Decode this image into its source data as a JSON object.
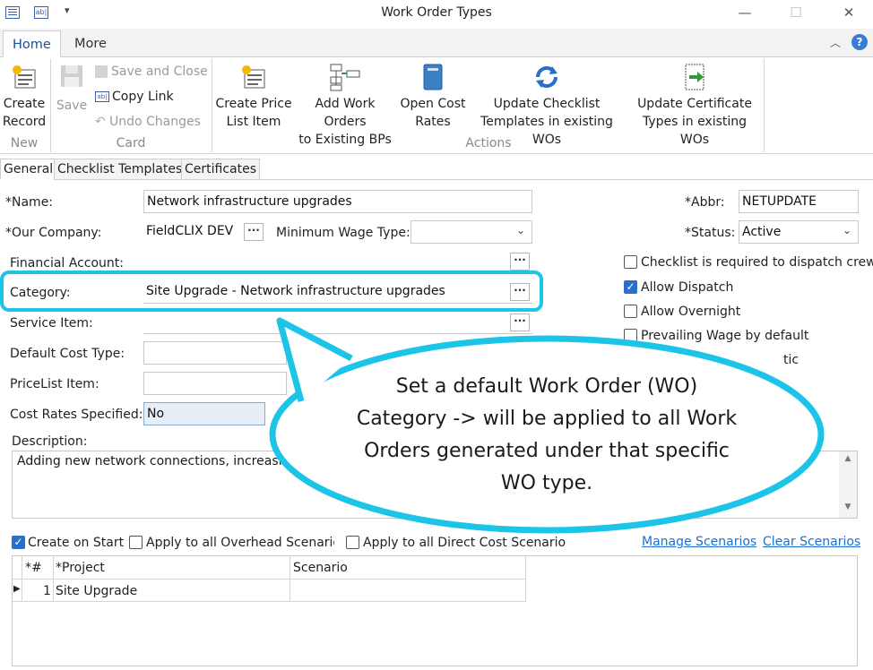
{
  "window": {
    "title": "Work Order Types",
    "minimize": "—",
    "maximize": "☐",
    "close": "✕"
  },
  "ribbon_tabs": [
    {
      "label": "Home"
    },
    {
      "label": "More"
    }
  ],
  "ribbon": {
    "new": {
      "create_record": [
        "Create",
        "Record"
      ],
      "group": "New"
    },
    "card": {
      "save": "Save",
      "save_close": "Save and Close",
      "copy_link": "Copy Link",
      "undo": "Undo Changes",
      "group": "Card"
    },
    "actions": {
      "create_price": [
        "Create Price",
        "List Item"
      ],
      "add_work_orders": [
        "Add Work Orders",
        "to Existing BPs"
      ],
      "open_cost": [
        "Open Cost",
        "Rates"
      ],
      "update_checklist": [
        "Update Checklist",
        "Templates in existing WOs"
      ],
      "update_cert": [
        "Update Certificate",
        "Types in existing WOs"
      ],
      "group": "Actions"
    }
  },
  "form_tabs": [
    {
      "label": "General"
    },
    {
      "label": "Checklist Templates"
    },
    {
      "label": "Certificates"
    }
  ],
  "form": {
    "name_label": "*Name:",
    "name_value": "Network infrastructure upgrades",
    "company_label": "*Our Company:",
    "company_value": "FieldCLIX DEV",
    "min_wage_label": "Minimum Wage Type:",
    "min_wage_value": "",
    "financial_label": "Financial Account:",
    "financial_value": "",
    "category_label": "Category:",
    "category_value": "Site Upgrade - Network infrastructure upgrades",
    "service_label": "Service Item:",
    "service_value": "",
    "cost_type_label": "Default Cost Type:",
    "cost_type_value": "",
    "pricelist_label": "PriceList Item:",
    "pricelist_value": "",
    "cost_rates_label": "Cost Rates Specified:",
    "cost_rates_value": "No",
    "description_label": "Description:",
    "description_value": "Adding new network connections, increasing",
    "abbr_label": "*Abbr:",
    "abbr_value": "NETUPDATE",
    "status_label": "*Status:",
    "status_value": "Active",
    "checklist_required": "Checklist is required to dispatch crew",
    "allow_dispatch": "Allow Dispatch",
    "allow_overnight": "Allow Overnight",
    "prevailing_wage": "Prevailing Wage by default",
    "partial_hidden": "tic"
  },
  "scenarios": {
    "create_on_start": "Create on Start",
    "apply_overhead": "Apply to all Overhead Scenarios",
    "apply_direct": "Apply to all Direct Cost Scenario",
    "manage": "Manage Scenarios",
    "clear": "Clear Scenarios"
  },
  "grid": {
    "headers": [
      "*#",
      "*Project",
      "Scenario"
    ],
    "rows": [
      {
        "num": "1",
        "project": "Site Upgrade",
        "scenario": ""
      }
    ],
    "row_indicator": "▶"
  },
  "callout": {
    "lines": [
      "Set a default Work Order (WO)",
      "Category -> will be applied to all Work",
      "Orders generated under that specific",
      "WO type."
    ]
  },
  "colors": {
    "accent": "#1cc4e8",
    "link": "#1e6fd0",
    "checkbox": "#2a6fc9"
  }
}
